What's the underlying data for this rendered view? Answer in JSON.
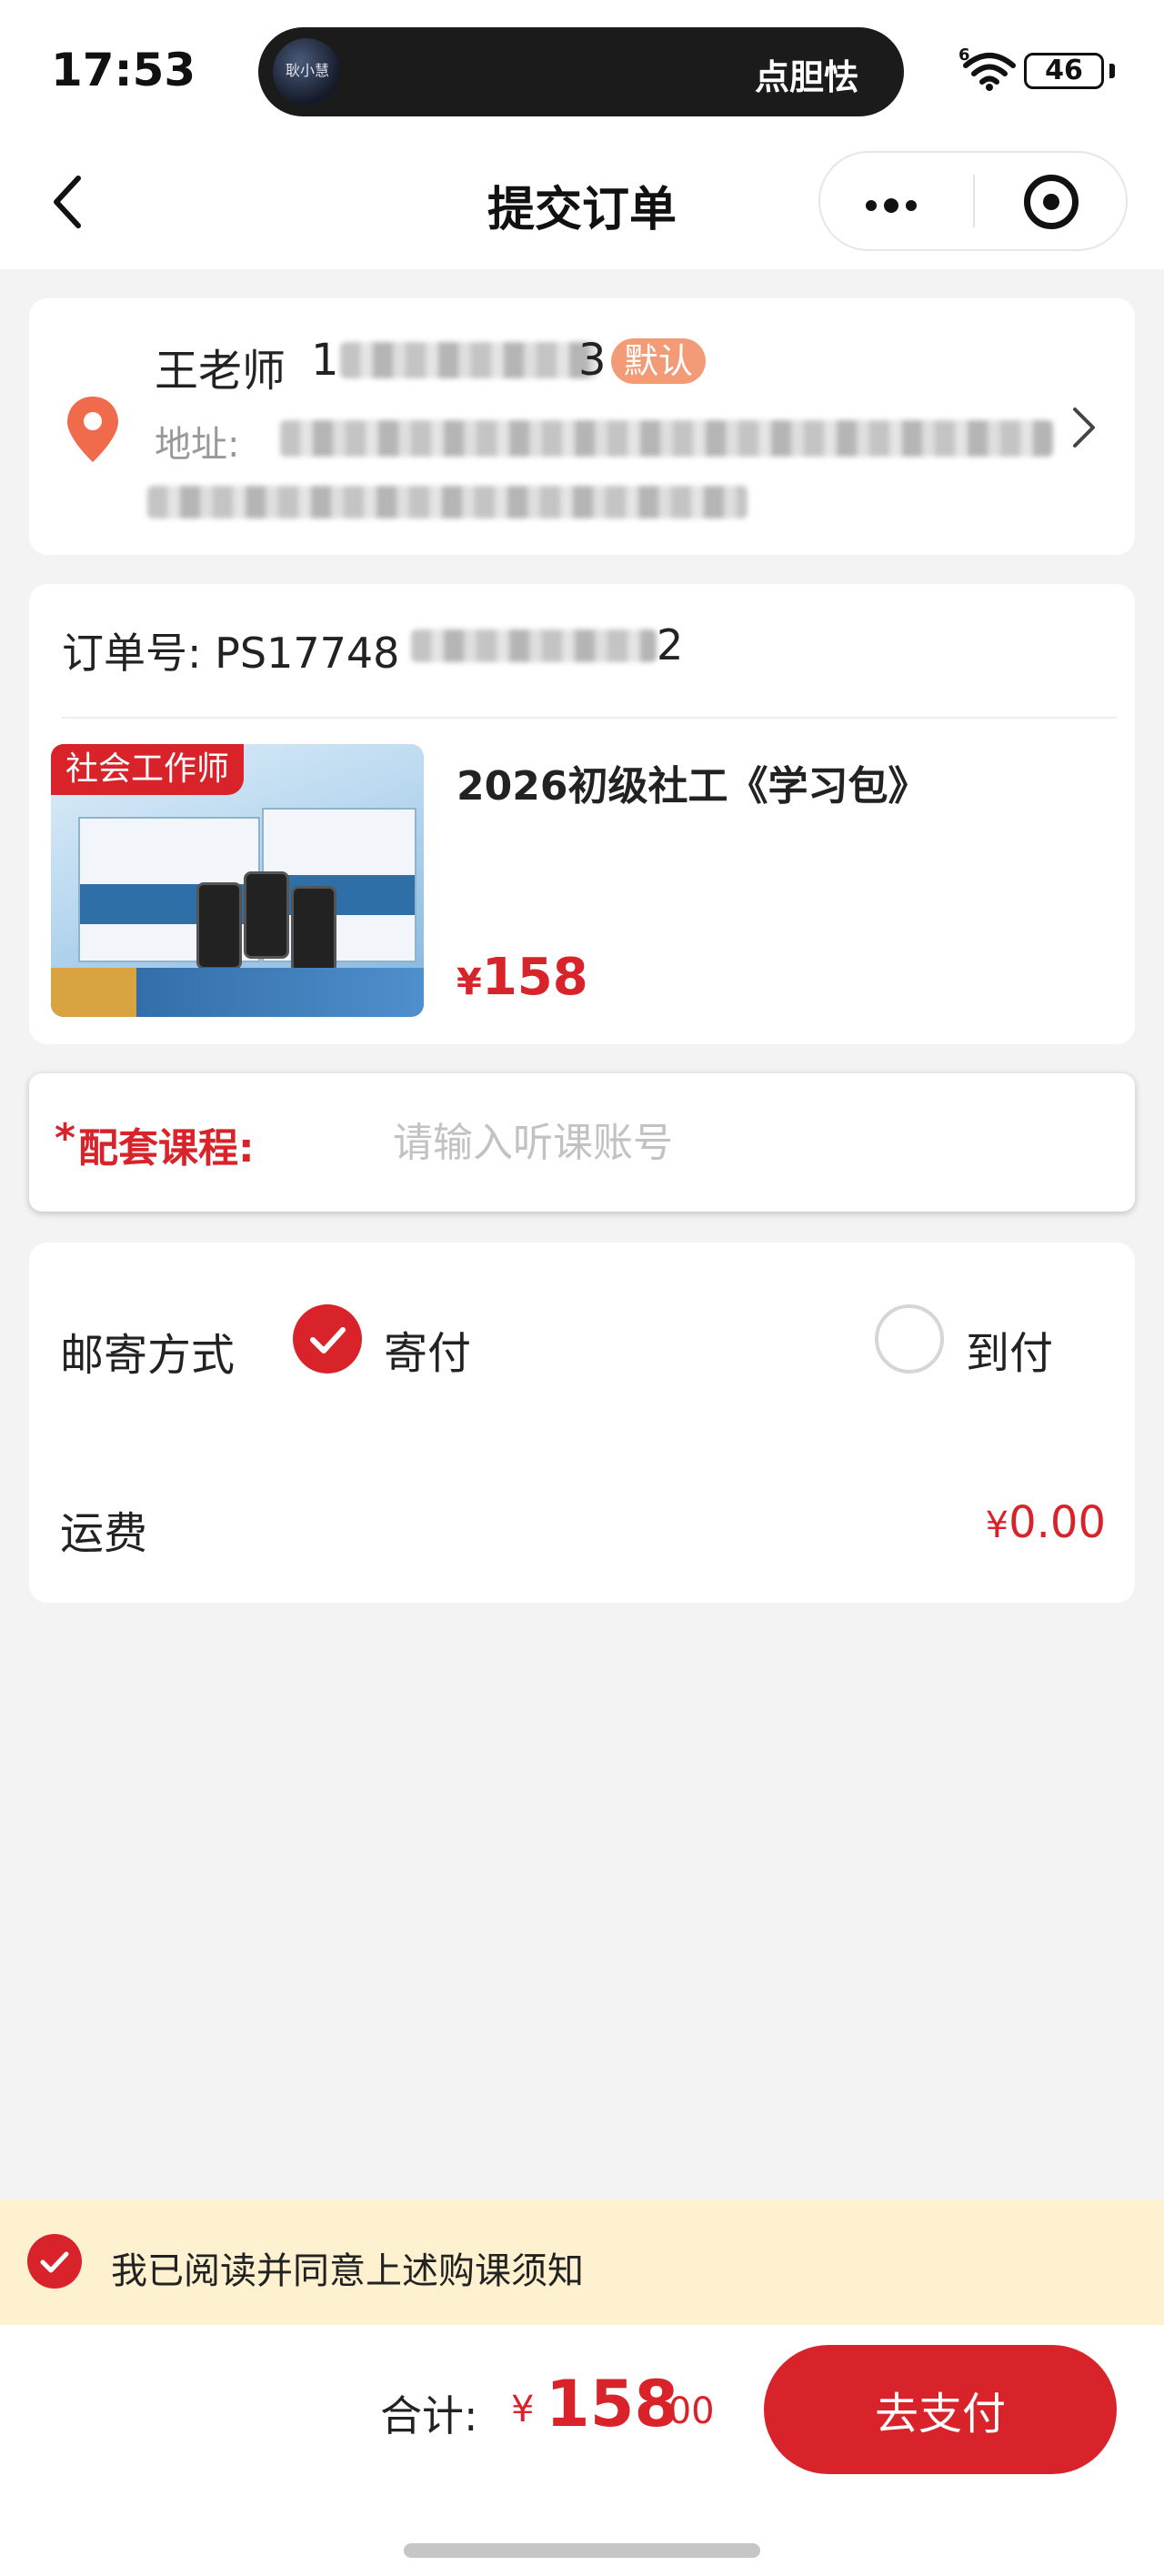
{
  "status_bar": {
    "time": "17:53",
    "now_playing_art_text": "耿小慧",
    "now_playing": "点胆怯",
    "signal_label": "6",
    "battery_level": "46",
    "battery_fraction": 0.46
  },
  "nav": {
    "title": "提交订单",
    "back_icon": "chevron-left-icon",
    "more_icon": "more-dots-icon",
    "close_icon": "target-close-icon"
  },
  "address": {
    "name": "王老师",
    "phone_prefix": "1",
    "phone_suffix": "3",
    "default_badge": "默认",
    "address_label": "地址:",
    "pin_icon": "location-pin-icon",
    "arrow_icon": "chevron-right-icon"
  },
  "order": {
    "number_label": "订单号:",
    "number_prefix": "PS17748",
    "number_suffix": "2",
    "product": {
      "tag": "社会工作师",
      "title": "2026初级社工《学习包》",
      "price_symbol": "¥",
      "price": "158"
    }
  },
  "course": {
    "required_mark": "*",
    "label": "配套课程:",
    "value": "",
    "placeholder": "请输入听课账号"
  },
  "shipping": {
    "label": "邮寄方式",
    "options": [
      {
        "label": "寄付",
        "selected": true
      },
      {
        "label": "到付",
        "selected": false
      }
    ],
    "fee_label": "运费",
    "fee_symbol": "¥",
    "fee_value": "0.00"
  },
  "agreement": {
    "checked": true,
    "text": "我已阅读并同意上述购课须知"
  },
  "checkout": {
    "total_label": "合计:",
    "total_symbol": "¥",
    "total_integer": "158",
    "total_decimal": ".00",
    "pay_button": "去支付"
  },
  "colors": {
    "accent": "#d9232b",
    "badge": "#f29b76",
    "agree_bg": "#fdf1cf",
    "page_bg": "#f3f3f3"
  }
}
